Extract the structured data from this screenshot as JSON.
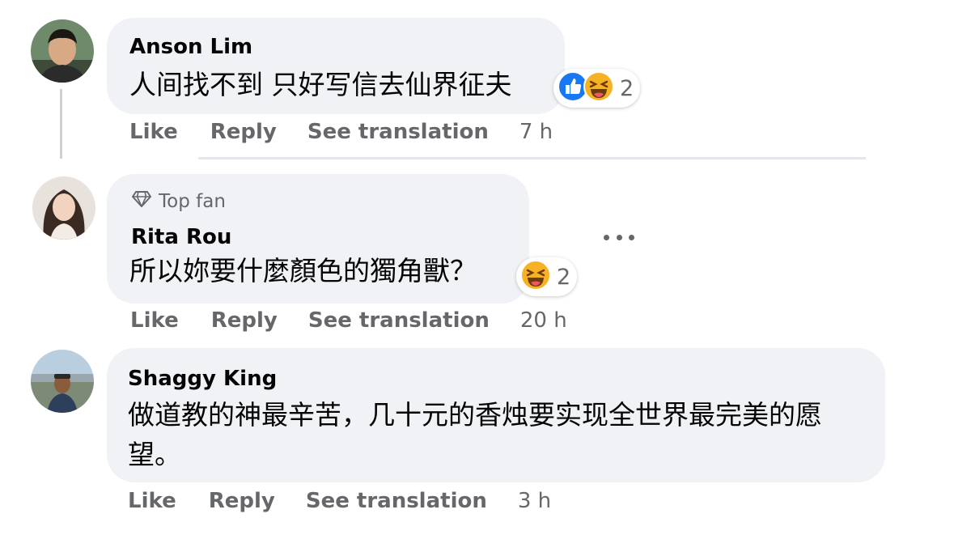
{
  "comments": [
    {
      "author": "Anson Lim",
      "text": "人间找不到 只好写信去仙界征夫",
      "reactions": {
        "icons": [
          "like-icon",
          "haha-icon"
        ],
        "count": "2"
      },
      "actions": {
        "like": "Like",
        "reply": "Reply",
        "translate": "See translation",
        "time": "7 h"
      }
    },
    {
      "badge": "Top fan",
      "author": "Rita Rou",
      "text": "所以妳要什麼顏色的獨角獸？",
      "reactions": {
        "icons": [
          "haha-icon"
        ],
        "count": "2"
      },
      "actions": {
        "like": "Like",
        "reply": "Reply",
        "translate": "See translation",
        "time": "20 h"
      }
    },
    {
      "author": "Shaggy King",
      "text": "做道教的神最辛苦，几十元的香烛要实现全世界最完美的愿望。",
      "actions": {
        "like": "Like",
        "reply": "Reply",
        "translate": "See translation",
        "time": "3 h"
      }
    }
  ],
  "colors": {
    "bubble": "#f0f2f5",
    "meta_text": "#65676b",
    "like_blue": "#1877f2",
    "haha_yellow": "#f7b125"
  }
}
